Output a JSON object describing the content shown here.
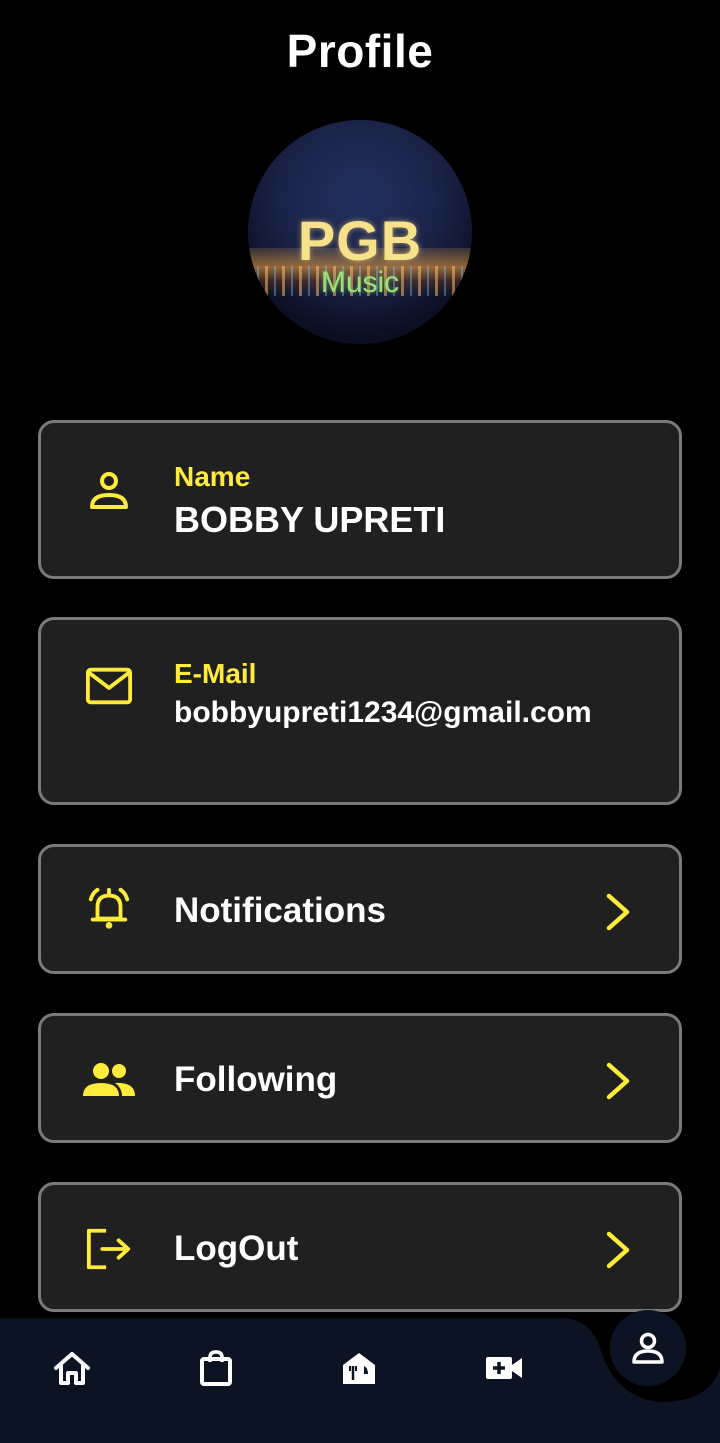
{
  "header": {
    "title": "Profile"
  },
  "avatar": {
    "logo_main": "PGB",
    "logo_sub": "Music"
  },
  "profile": {
    "name_label": "Name",
    "name_value": "BOBBY UPRETI",
    "email_label": "E-Mail",
    "email_value": "bobbyupreti1234@gmail.com"
  },
  "menu": {
    "notifications_label": "Notifications",
    "following_label": "Following",
    "logout_label": "LogOut"
  },
  "icons": {
    "name": "person-icon",
    "email": "mail-icon",
    "notifications": "alarm-bell-icon",
    "following": "people-icon",
    "logout": "logout-icon",
    "chevron": "chevron-right-icon",
    "nav": [
      "home-icon",
      "shopping-bag-icon",
      "restaurant-icon",
      "video-call-icon",
      "profile-icon"
    ]
  },
  "colors": {
    "accent": "#ffeb3b",
    "card_background": "#202020",
    "card_border": "#7a7a7a",
    "navbar_background": "#0c1424"
  }
}
